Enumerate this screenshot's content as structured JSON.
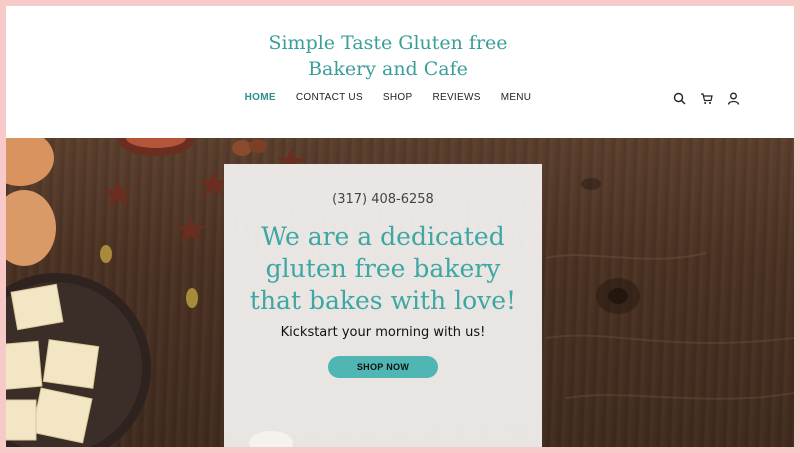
{
  "site": {
    "title_line1": "Simple Taste Gluten free",
    "title_line2": "Bakery and Cafe",
    "accent_color": "#3a9e9a"
  },
  "nav": {
    "items": [
      {
        "label": "HOME",
        "active": true
      },
      {
        "label": "CONTACT US",
        "active": false
      },
      {
        "label": "SHOP",
        "active": false
      },
      {
        "label": "REVIEWS",
        "active": false
      },
      {
        "label": "MENU",
        "active": false
      }
    ]
  },
  "header_icons": [
    "search-icon",
    "cart-icon",
    "account-icon"
  ],
  "hero": {
    "phone": "(317) 408-6258",
    "headline": "We are a dedicated gluten free bakery that bakes with love!",
    "subline": "Kickstart your morning with us!",
    "cta_label": "SHOP NOW",
    "cta_color": "#4fb6b3"
  }
}
